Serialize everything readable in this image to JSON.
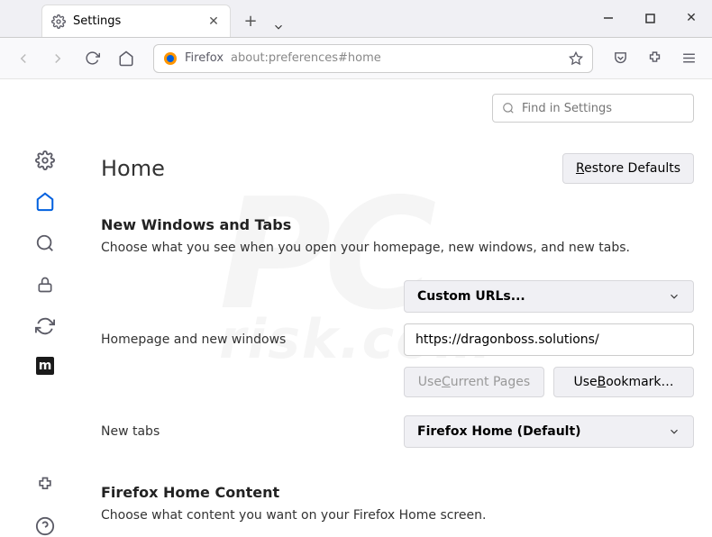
{
  "titlebar": {
    "tab_title": "Settings"
  },
  "toolbar": {
    "identity_label": "Firefox",
    "url": "about:preferences#home"
  },
  "search": {
    "placeholder": "Find in Settings"
  },
  "page": {
    "title": "Home",
    "restore_defaults": "Restore Defaults"
  },
  "sections": {
    "new_windows": {
      "heading": "New Windows and Tabs",
      "desc": "Choose what you see when you open your homepage, new windows, and new tabs.",
      "homepage_label": "Homepage and new windows",
      "homepage_select": "Custom URLs...",
      "homepage_url": "https://dragonboss.solutions/",
      "use_current": "Use Current Pages",
      "use_bookmark": "Use Bookmark…",
      "newtabs_label": "New tabs",
      "newtabs_select": "Firefox Home (Default)"
    },
    "home_content": {
      "heading": "Firefox Home Content",
      "desc": "Choose what content you want on your Firefox Home screen."
    }
  }
}
